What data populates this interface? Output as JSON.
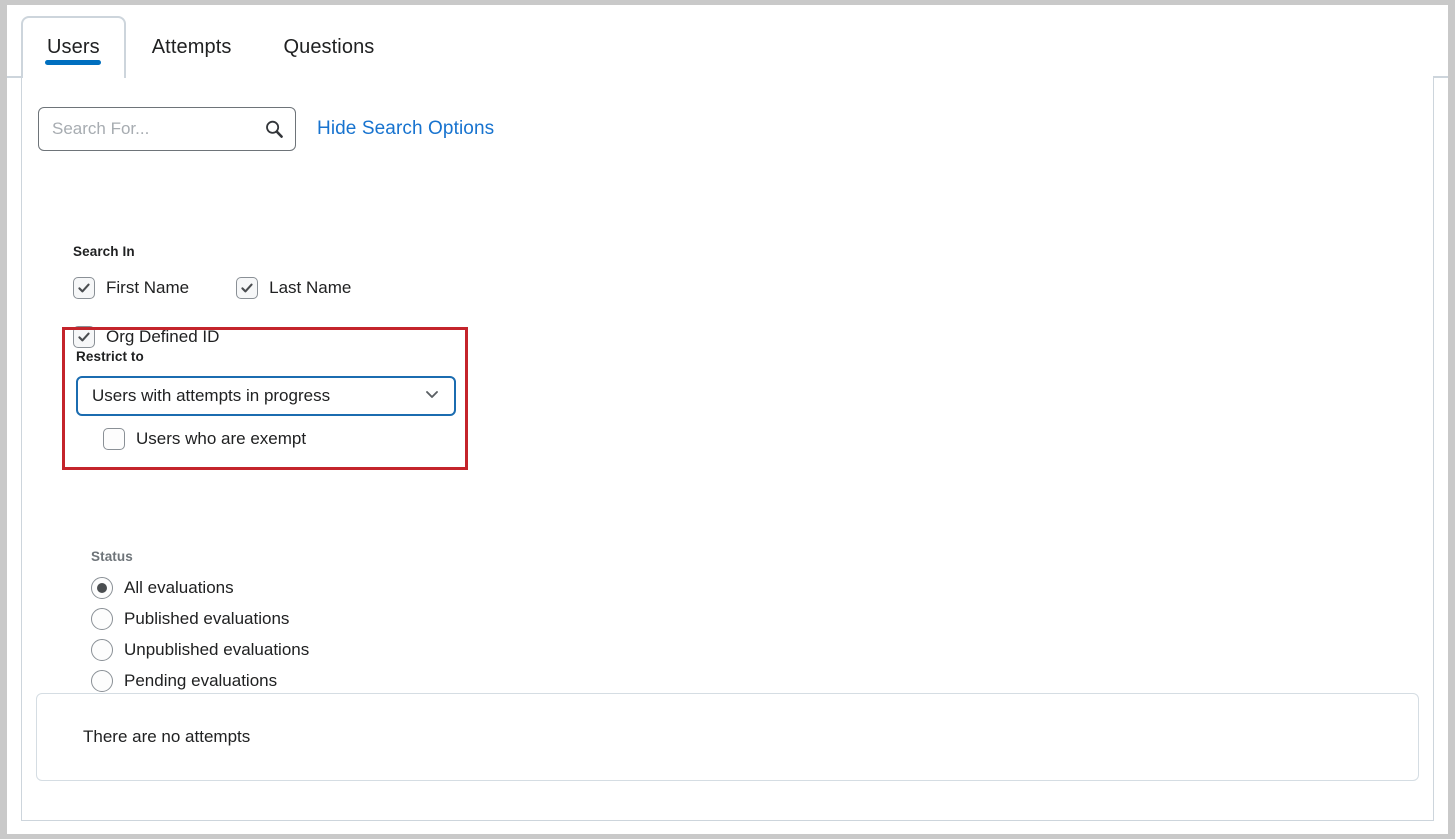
{
  "colors": {
    "accent_blue": "#006fbf",
    "link_blue": "#1773cf",
    "focus_blue": "#1b6cb0",
    "highlight_red": "#c4242b",
    "border_gray": "#cdd5dc",
    "text_dark": "#202122",
    "text_muted": "#6e7479"
  },
  "tabs": [
    {
      "label": "Users",
      "active": true
    },
    {
      "label": "Attempts",
      "active": false
    },
    {
      "label": "Questions",
      "active": false
    }
  ],
  "search": {
    "value": "",
    "placeholder": "Search For...",
    "icon": "search-icon",
    "toggle_options_label": "Hide Search Options"
  },
  "search_in": {
    "label": "Search In",
    "options": [
      {
        "label": "First Name",
        "checked": true
      },
      {
        "label": "Last Name",
        "checked": true
      },
      {
        "label": "Org Defined ID",
        "checked": true
      }
    ]
  },
  "restrict_to": {
    "label": "Restrict to",
    "dropdown": {
      "selected": "Users with attempts in progress",
      "icon": "chevron-down-icon"
    },
    "exempt_checkbox": {
      "label": "Users who are exempt",
      "checked": false
    },
    "highlighted": true
  },
  "status": {
    "label": "Status",
    "options": [
      {
        "label": "All evaluations",
        "selected": true
      },
      {
        "label": "Published evaluations",
        "selected": false
      },
      {
        "label": "Unpublished evaluations",
        "selected": false
      },
      {
        "label": "Pending evaluations",
        "selected": false
      }
    ]
  },
  "results": {
    "empty_message": "There are no attempts"
  }
}
